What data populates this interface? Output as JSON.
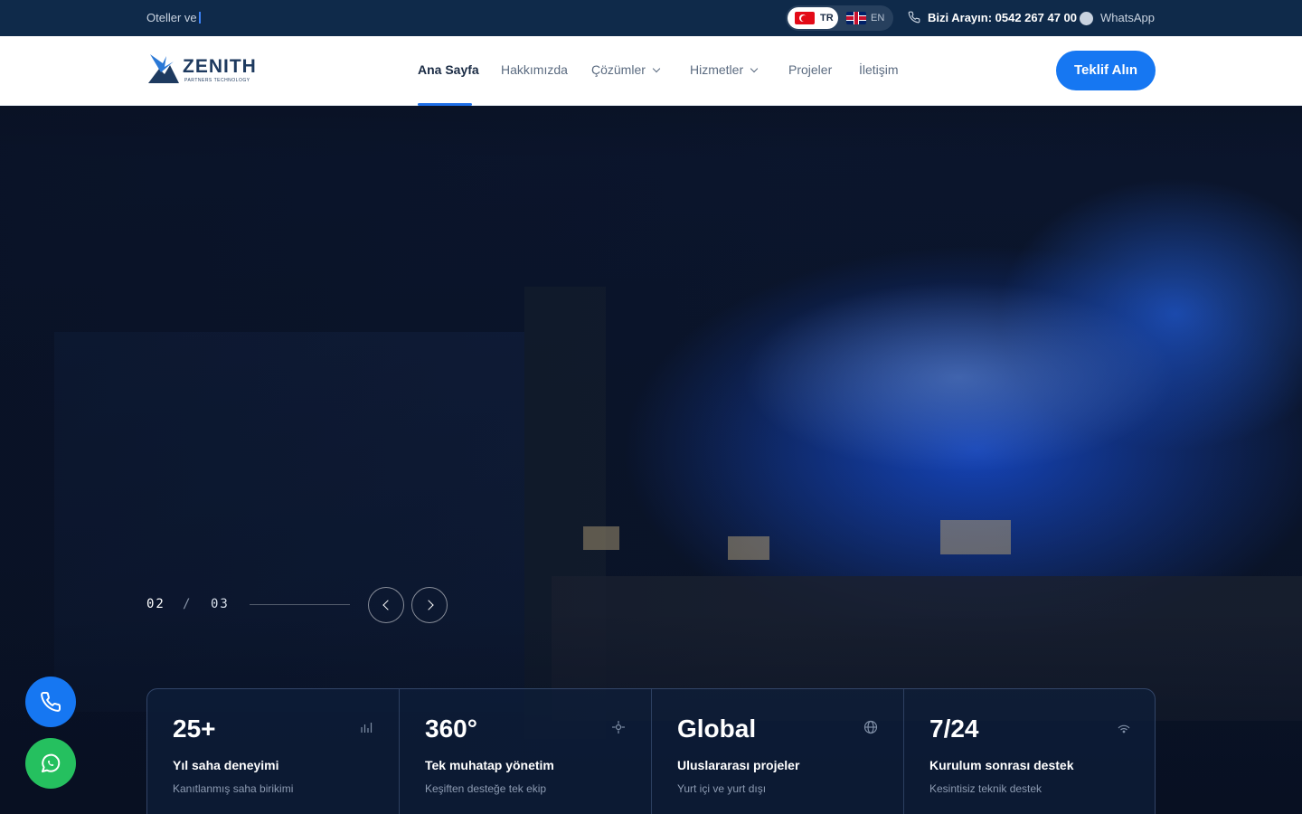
{
  "topbar": {
    "typing_text": "Oteller ve",
    "lang_tr": "TR",
    "lang_en": "EN",
    "call_text": "Bizi Arayın: 0542 267 47 00",
    "whatsapp_text": "WhatsApp"
  },
  "header": {
    "logo_name": "ZENITH",
    "logo_sub": "PARTNERS TECHNOLOGY",
    "nav": {
      "home": "Ana Sayfa",
      "about": "Hakkımızda",
      "solutions": "Çözümler",
      "services": "Hizmetler",
      "projects": "Projeler",
      "contact": "İletişim"
    },
    "cta": "Teklif Alın"
  },
  "hero": {
    "slide_current": "02",
    "slide_separator": "/",
    "slide_total": "03"
  },
  "stats": [
    {
      "value": "25+",
      "title": "Yıl saha deneyimi",
      "subtitle": "Kanıtlanmış saha birikimi",
      "icon": "chart-bars-icon"
    },
    {
      "value": "360°",
      "title": "Tek muhatap yönetim",
      "subtitle": "Keşiften desteğe tek ekip",
      "icon": "crosshair-icon"
    },
    {
      "value": "Global",
      "title": "Uluslararası projeler",
      "subtitle": "Yurt içi ve yurt dışı",
      "icon": "globe-icon"
    },
    {
      "value": "7/24",
      "title": "Kurulum sonrası destek",
      "subtitle": "Kesintisiz teknik destek",
      "icon": "signal-icon"
    }
  ],
  "colors": {
    "accent": "#1677f2",
    "topbar_bg": "#0f2a4a",
    "whatsapp": "#25c05f"
  }
}
